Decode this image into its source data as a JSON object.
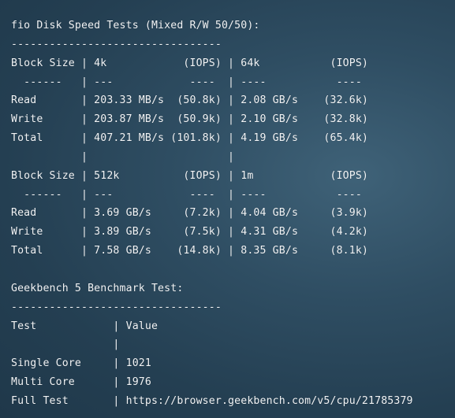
{
  "terminal": {
    "lines": [
      "fio Disk Speed Tests (Mixed R/W 50/50):",
      "---------------------------------",
      "Block Size | 4k            (IOPS) | 64k           (IOPS)",
      "  ------   | ---            ----  | ----           ---- ",
      "Read       | 203.33 MB/s  (50.8k) | 2.08 GB/s    (32.6k)",
      "Write      | 203.87 MB/s  (50.9k) | 2.10 GB/s    (32.8k)",
      "Total      | 407.21 MB/s (101.8k) | 4.19 GB/s    (65.4k)",
      "           |                      |                     ",
      "Block Size | 512k          (IOPS) | 1m            (IOPS)",
      "  ------   | ---            ----  | ----           ---- ",
      "Read       | 3.69 GB/s     (7.2k) | 4.04 GB/s     (3.9k)",
      "Write      | 3.89 GB/s     (7.5k) | 4.31 GB/s     (4.2k)",
      "Total      | 7.58 GB/s    (14.8k) | 8.35 GB/s     (8.1k)",
      "",
      "Geekbench 5 Benchmark Test:",
      "---------------------------------",
      "Test            | Value",
      "                |",
      "Single Core     | 1021",
      "Multi Core      | 1976",
      "Full Test       | https://browser.geekbench.com/v5/cpu/21785379"
    ]
  }
}
